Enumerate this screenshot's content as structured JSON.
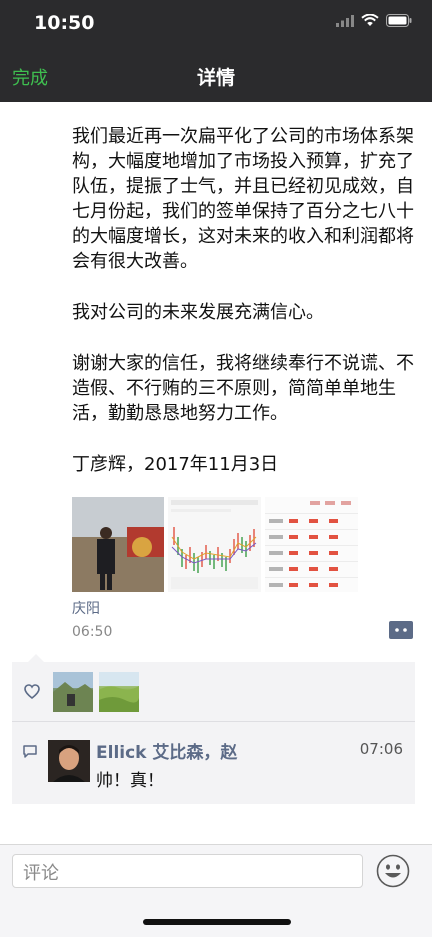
{
  "status_bar": {
    "time": "10:50"
  },
  "nav": {
    "done_label": "完成",
    "title": "详情"
  },
  "post": {
    "paragraphs": [
      "我们最近再一次扁平化了公司的市场体系架构，大幅度地增加了市场投入预算，扩充了队伍，提振了士气，并且已经初见成效，自七月份起，我们的签单保持了百分之七八十的大幅度增长，这对未来的收入和利润都将会有很大改善。",
      "我对公司的未来发展充满信心。",
      "谢谢大家的信任，我将继续奉行不说谎、不造假、不行贿的三不原则，简简单单地生活，勤勤恳恳地努力工作。",
      "丁彦辉，2017年11月3日"
    ],
    "location": "庆阳",
    "time": "06:50"
  },
  "feedback": {
    "likes": [
      "avatar-landscape-mountain",
      "avatar-landscape-field"
    ],
    "comments": [
      {
        "author": "Ellick 艾比森，赵",
        "time": "07:06",
        "text": "帅！真！"
      }
    ]
  },
  "input": {
    "placeholder": "评论"
  },
  "colors": {
    "accent_green": "#3fbf50",
    "link_blue": "#5c6b87",
    "chart_red": "#e25241",
    "chart_green": "#3a9d46"
  }
}
